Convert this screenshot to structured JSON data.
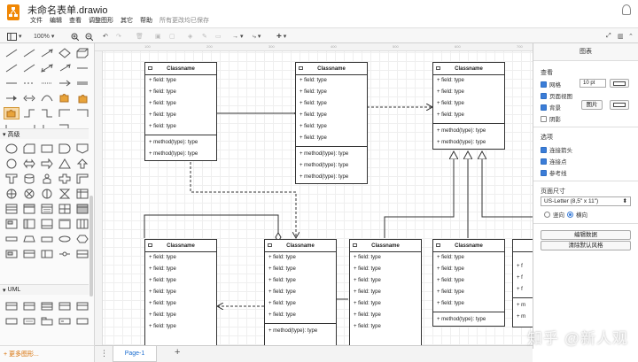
{
  "app": {
    "title": "未命名表单.drawio",
    "save_status": "所有更改均已保存"
  },
  "menu": [
    "文件",
    "编辑",
    "查看",
    "调整图形",
    "其它",
    "帮助"
  ],
  "toolbar": {
    "zoom": "100%"
  },
  "left_panel": {
    "section_advanced": "高级",
    "section_uml": "UML",
    "more_shapes": "+ 更多图形..."
  },
  "ruler": [
    "100",
    "200",
    "300",
    "400",
    "500",
    "600",
    "700"
  ],
  "classes": [
    {
      "title": "Classname",
      "fields": [
        "+ field: type",
        "+ field: type",
        "+ field: type",
        "+ field: type",
        "+ field: type"
      ],
      "methods": [
        "+ method(type): type",
        "+ method(type): type"
      ]
    },
    {
      "title": "Classname",
      "fields": [
        "+ field: type",
        "+ field: type",
        "+ field: type",
        "+ field: type",
        "+ field: type",
        "+ field: type"
      ],
      "methods": [
        "+ method(type): type",
        "+ method(type): type",
        "+ method(type): type"
      ]
    },
    {
      "title": "Classname",
      "fields": [
        "+ field: type",
        "+ field: type",
        "+ field: type",
        "+ field: type"
      ],
      "methods": [
        "+ method(type): type",
        "+ method(type): type"
      ]
    },
    {
      "title": "Classname",
      "fields": [
        "+ field: type",
        "+ field: type",
        "+ field: type",
        "+ field: type",
        "+ field: type",
        "+ field: type",
        "+ field: type"
      ],
      "methods": []
    },
    {
      "title": "Classname",
      "fields": [
        "+ field: type",
        "+ field: type",
        "+ field: type",
        "+ field: type",
        "+ field: type",
        "+ field: type"
      ],
      "methods": [
        "+ method(type): type"
      ]
    },
    {
      "title": "Classname",
      "fields": [
        "+ field: type",
        "+ field: type",
        "+ field: type",
        "+ field: type",
        "+ field: type",
        "+ field: type",
        "+ field: type"
      ],
      "methods": []
    },
    {
      "title": "Classname",
      "fields": [
        "+ field: type",
        "+ field: type",
        "+ field: type",
        "+ field: type",
        "+ field: type"
      ],
      "methods": [
        "+ method(type): type"
      ]
    }
  ],
  "partial_class_rows": [
    "+ f",
    "+ f",
    "+ f",
    "+ m",
    "+ m"
  ],
  "right_panel": {
    "title": "图表",
    "view_label": "查看",
    "grid": "网格",
    "grid_size": "10 pt",
    "page_view": "页面视图",
    "background": "背景",
    "image_button": "图片",
    "shadow": "阴影",
    "options_label": "选项",
    "connection_arrows": "连接箭头",
    "connection_points": "连接点",
    "guides": "参考线",
    "paper_size_label": "页面尺寸",
    "paper_size": "US-Letter (8,5\" x 11\")",
    "portrait": "竖向",
    "landscape": "横向",
    "edit_data": "编辑数据",
    "clear_style": "清除默认风格"
  },
  "page_tab": "Page-1",
  "watermark": "知乎 @新人观"
}
